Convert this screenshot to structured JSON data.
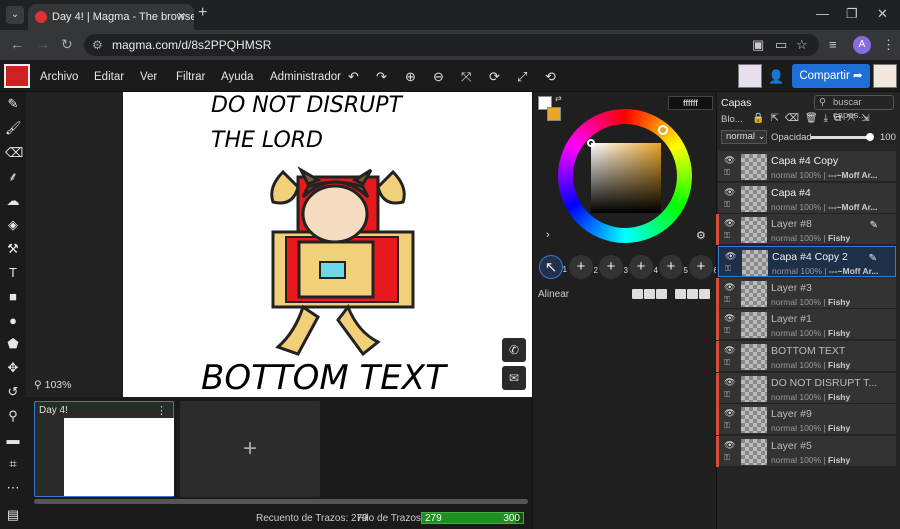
{
  "browser": {
    "tab_title": "Day 4! | Magma - The browser",
    "url": "magma.com/d/8s2PPQHMSR",
    "profile_initial": "A"
  },
  "menu": [
    "Archivo",
    "Editar",
    "Ver",
    "Filtrar",
    "Ayuda",
    "Administrador"
  ],
  "share_label": "Compartir",
  "canvas": {
    "zoom": "103%",
    "text_top_1": "DO NOT DISRUPT",
    "text_top_2": "THE LORD",
    "text_bottom": "BOTTOM TEXT"
  },
  "drawing_card": {
    "title": "Day 4!"
  },
  "status": {
    "strokes_label": "Recuento de Trazos: 279",
    "thread_label": "Hilo de Trazos:",
    "thread_value": "279",
    "thread_max": "300",
    "thread_fraction": 0.93
  },
  "color": {
    "hex": "ffffff",
    "primary": "#ffffff",
    "secondary": "#e8a52a",
    "align_label": "Alinear",
    "brush_slots": [
      "1",
      "2",
      "3",
      "4",
      "5",
      "6"
    ]
  },
  "layers_panel": {
    "title": "Capas",
    "search_placeholder": "buscar capas...",
    "blend_short": "Blo...",
    "mode": "normal",
    "opacity_label": "Opacidad",
    "opacity_value": "100",
    "layers": [
      {
        "name": "Capa #4 Copy",
        "meta": "normal 100% |",
        "owner": "---~Moff Ar...",
        "active": true,
        "accent": ""
      },
      {
        "name": "Capa #4",
        "meta": "normal 100% |",
        "owner": "---~Moff Ar...",
        "active": true,
        "accent": ""
      },
      {
        "name": "Layer #8",
        "meta": "normal 100% |",
        "owner": "Fishy",
        "active": false,
        "accent": "#d84a3a"
      },
      {
        "name": "Capa #4 Copy 2",
        "meta": "normal 100% |",
        "owner": "---~Moff Ar...",
        "active": true,
        "accent": ""
      },
      {
        "name": "Layer #3",
        "meta": "normal 100% |",
        "owner": "Fishy",
        "active": false,
        "accent": "#d84a3a"
      },
      {
        "name": "Layer #1",
        "meta": "normal 100% |",
        "owner": "Fishy",
        "active": false,
        "accent": "#d84a3a"
      },
      {
        "name": "BOTTOM TEXT",
        "meta": "normal 100% |",
        "owner": "Fishy",
        "active": false,
        "accent": "#d84a3a"
      },
      {
        "name": "DO NOT DISRUPT T...",
        "meta": "normal 100% |",
        "owner": "Fishy",
        "active": false,
        "accent": "#d84a3a"
      },
      {
        "name": "Layer #9",
        "meta": "normal 100% |",
        "owner": "Fishy",
        "active": false,
        "accent": "#d84a3a"
      },
      {
        "name": "Layer #5",
        "meta": "normal 100% |",
        "owner": "Fishy",
        "active": false,
        "accent": "#d84a3a"
      }
    ]
  }
}
